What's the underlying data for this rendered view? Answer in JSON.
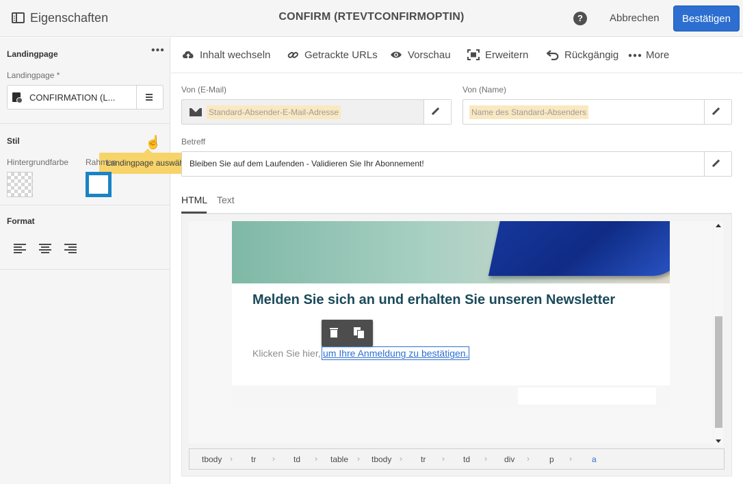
{
  "topbar": {
    "panel_label": "Eigenschaften",
    "title": "CONFIRM (RTEVTCONFIRMOPTIN)",
    "help": "?",
    "cancel": "Abbrechen",
    "confirm": "Bestätigen",
    "confirm_color": "#2d6fd0"
  },
  "left": {
    "landing_section": "Landingpage",
    "landing_label": "Landingpage *",
    "landing_value": "CONFIRMATION  (L...",
    "tooltip": "Landingpage auswählen",
    "style_section": "Stil",
    "bg_label": "Hintergrundfarbe",
    "border_label": "Rahmen",
    "border_color": "#1a83c6",
    "format_section": "Format",
    "align_icons": [
      "align-left-icon",
      "align-center-icon",
      "align-right-icon"
    ]
  },
  "toolbar": {
    "items": [
      {
        "label": "Inhalt wechseln",
        "icon": "cloud-upload-icon"
      },
      {
        "label": "Getrackte URLs",
        "icon": "link-icon"
      },
      {
        "label": "Vorschau",
        "icon": "eye-icon"
      },
      {
        "label": "Erweitern",
        "icon": "expand-icon"
      },
      {
        "label": "Rückgängig",
        "icon": "undo-icon"
      },
      {
        "label": "More",
        "icon": "more-icon"
      }
    ]
  },
  "form": {
    "from_email_label": "Von (E-Mail)",
    "from_email_value": "Standard-Absender-E-Mail-Adresse",
    "from_name_label": "Von (Name)",
    "from_name_value": "Name des Standard-Absenders",
    "subject_label": "Betreff",
    "subject_value": "Bleiben Sie auf dem Laufenden -  Validieren Sie Ihr Abonnement!"
  },
  "tabs": [
    "HTML",
    "Text"
  ],
  "email": {
    "headline": "Melden Sie sich an und erhalten Sie unseren Newsletter",
    "body_text": "Klicken Sie hier,",
    "link_text": "um Ihre Anmeldung zu bestätigen."
  },
  "breadcrumb": [
    "tbody",
    "tr",
    "td",
    "table",
    "tbody",
    "tr",
    "td",
    "div",
    "p",
    "a"
  ]
}
